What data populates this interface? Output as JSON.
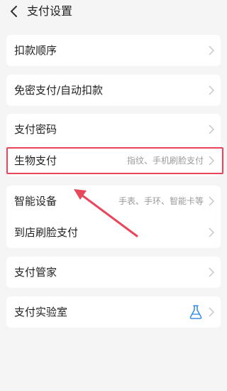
{
  "header": {
    "title": "支付设置",
    "back_icon": "back-chevron-icon"
  },
  "rows": {
    "deduct_order": {
      "label": "扣款顺序"
    },
    "auto_deduct": {
      "label": "免密支付/自动扣款"
    },
    "pay_password": {
      "label": "支付密码"
    },
    "biometric": {
      "label": "生物支付",
      "sub": "指纹、手机刷脸支付"
    },
    "smart_device": {
      "label": "智能设备",
      "sub": "手表、手环、智能卡等"
    },
    "face_pay": {
      "label": "到店刷脸支付"
    },
    "pay_butler": {
      "label": "支付管家"
    },
    "pay_lab": {
      "label": "支付实验室",
      "icon": "flask-icon"
    }
  },
  "annotation": {
    "highlight_color": "#e8475b"
  }
}
